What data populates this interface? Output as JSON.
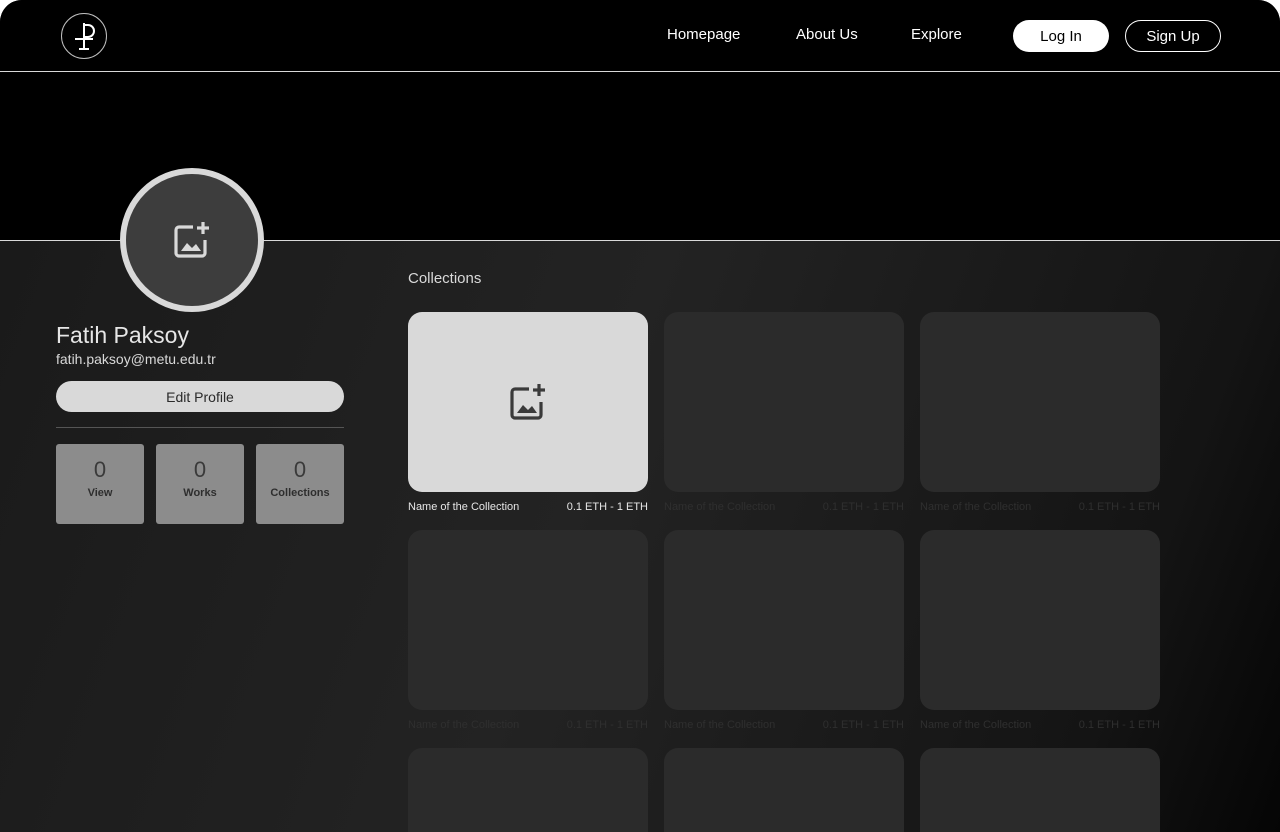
{
  "navbar": {
    "logo_icon": "p-monogram-icon",
    "links": [
      "Homepage",
      "About Us",
      "Explore"
    ],
    "login_label": "Log In",
    "signup_label": "Sign Up"
  },
  "profile": {
    "avatar_icon": "add-image-icon",
    "name": "Fatih Paksoy",
    "email": "fatih.paksoy@metu.edu.tr",
    "edit_label": "Edit Profile",
    "stats": [
      {
        "value": "0",
        "label": "View"
      },
      {
        "value": "0",
        "label": "Works"
      },
      {
        "value": "0",
        "label": "Collections"
      }
    ]
  },
  "collections": {
    "title": "Collections",
    "add_icon": "add-image-icon",
    "items": [
      {
        "name": "Name of the Collection",
        "price": "0.1 ETH - 1 ETH"
      },
      {
        "name": "Name of the Collection",
        "price": "0.1 ETH - 1 ETH"
      },
      {
        "name": "Name of the Collection",
        "price": "0.1 ETH - 1 ETH"
      },
      {
        "name": "Name of the Collection",
        "price": "0.1 ETH - 1 ETH"
      },
      {
        "name": "Name of the Collection",
        "price": "0.1 ETH - 1 ETH"
      },
      {
        "name": "Name of the Collection",
        "price": "0.1 ETH - 1 ETH"
      }
    ]
  },
  "colors": {
    "background": "#000000",
    "panel": "#1e1e1e",
    "card": "#2b2b2b",
    "card_active": "#d9d9d9",
    "stat_box": "#8c8c8c",
    "accent": "#ffffff"
  }
}
